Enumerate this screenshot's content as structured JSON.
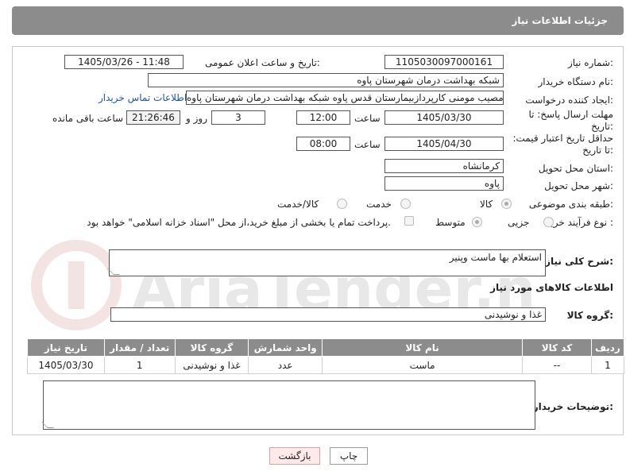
{
  "header": {
    "title": "جزئیات اطلاعات نیاز"
  },
  "fields": {
    "need_number_label": "شماره نیاز:",
    "need_number": "1105030097000161",
    "announce_label": "تاریخ و ساعت اعلان عمومی:",
    "announce_value": "1405/03/26 - 11:48",
    "buyer_org_label": "نام دستگاه خریدار:",
    "buyer_org": "شبکه بهداشت درمان شهرستان پاوه",
    "creator_label": "ایجاد کننده درخواست:",
    "creator": "مصیب مومنی کارپردازبیمارستان قدس پاوه شبکه بهداشت درمان شهرستان پاوه",
    "contact_link": "اطلاعات تماس خریدار",
    "reply_deadline_label": "مهلت ارسال پاسخ: تا تاریخ:",
    "reply_date": "1405/03/30",
    "time_label": "ساعت",
    "reply_time": "12:00",
    "days_value": "3",
    "days_label": "روز و",
    "remaining_value": "21:26:46",
    "remaining_label": "ساعت باقی مانده",
    "price_validity_label": "حداقل تاریخ اعتبار قیمت: تا تاریخ:",
    "price_date": "1405/04/30",
    "price_time": "08:00",
    "province_label": "استان محل تحویل:",
    "province": "کرمانشاه",
    "city_label": "شهر محل تحویل:",
    "city": "پاوه",
    "category_label": "طبقه بندی موضوعی:",
    "category_options": [
      "کالا",
      "خدمت",
      "کالا/خدمت"
    ],
    "process_label": "نوع فرآیند خرید :",
    "process_options": [
      "جزیی",
      "متوسط"
    ],
    "payment_note": "پرداخت تمام یا بخشی از مبلغ خرید،از محل \"اسناد خزانه اسلامی\" خواهد بود."
  },
  "description": {
    "label": "شرح کلی نیاز:",
    "value": "استعلام بها ماست وپنیر"
  },
  "goods_section": {
    "title": "اطلاعات کالاهای مورد نیاز",
    "group_label": "گروه کالا:",
    "group_value": "غذا و نوشیدنی"
  },
  "table": {
    "columns": [
      "ردیف",
      "کد کالا",
      "نام کالا",
      "واحد شمارش",
      "گروه کالا",
      "تعداد / مقدار",
      "تاریخ نیاز"
    ],
    "rows": [
      [
        "1",
        "--",
        "ماست",
        "عدد",
        "غذا و نوشیدنی",
        "1",
        "1405/03/30"
      ]
    ]
  },
  "buyer_notes": {
    "label": "توضیحات خریدار:",
    "value": ""
  },
  "buttons": {
    "print": "چاپ",
    "back": "بازگشت"
  },
  "watermark": {
    "text": "AriaTender.net"
  },
  "colors": {
    "header_bg": "#8c8c8c",
    "link": "#1a55b0",
    "back_button_bg": "#ffe9e9"
  }
}
